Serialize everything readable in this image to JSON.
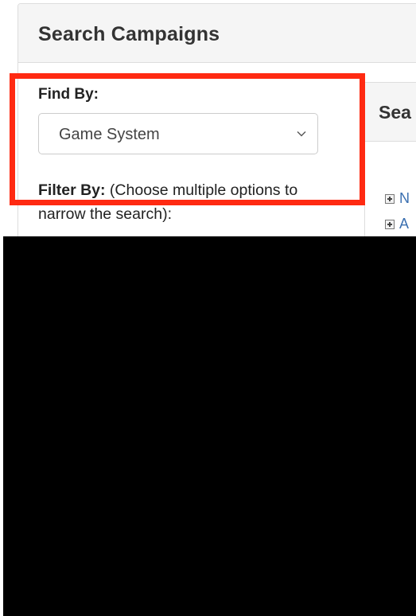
{
  "panel": {
    "title": "Search Campaigns"
  },
  "find_by": {
    "label": "Find By:",
    "selected": "Game System"
  },
  "filter_by": {
    "label": "Filter By:",
    "hint": " (Choose multiple options to narrow the search):"
  },
  "results": {
    "title": "Sea",
    "items": [
      "N",
      "A"
    ]
  },
  "colors": {
    "highlight": "#ff2a12",
    "link": "#3a6fb0",
    "redaction": "#000000"
  },
  "icons": {
    "select_arrow": "chevron-down-icon",
    "tree_expand": "plus-box-icon"
  }
}
